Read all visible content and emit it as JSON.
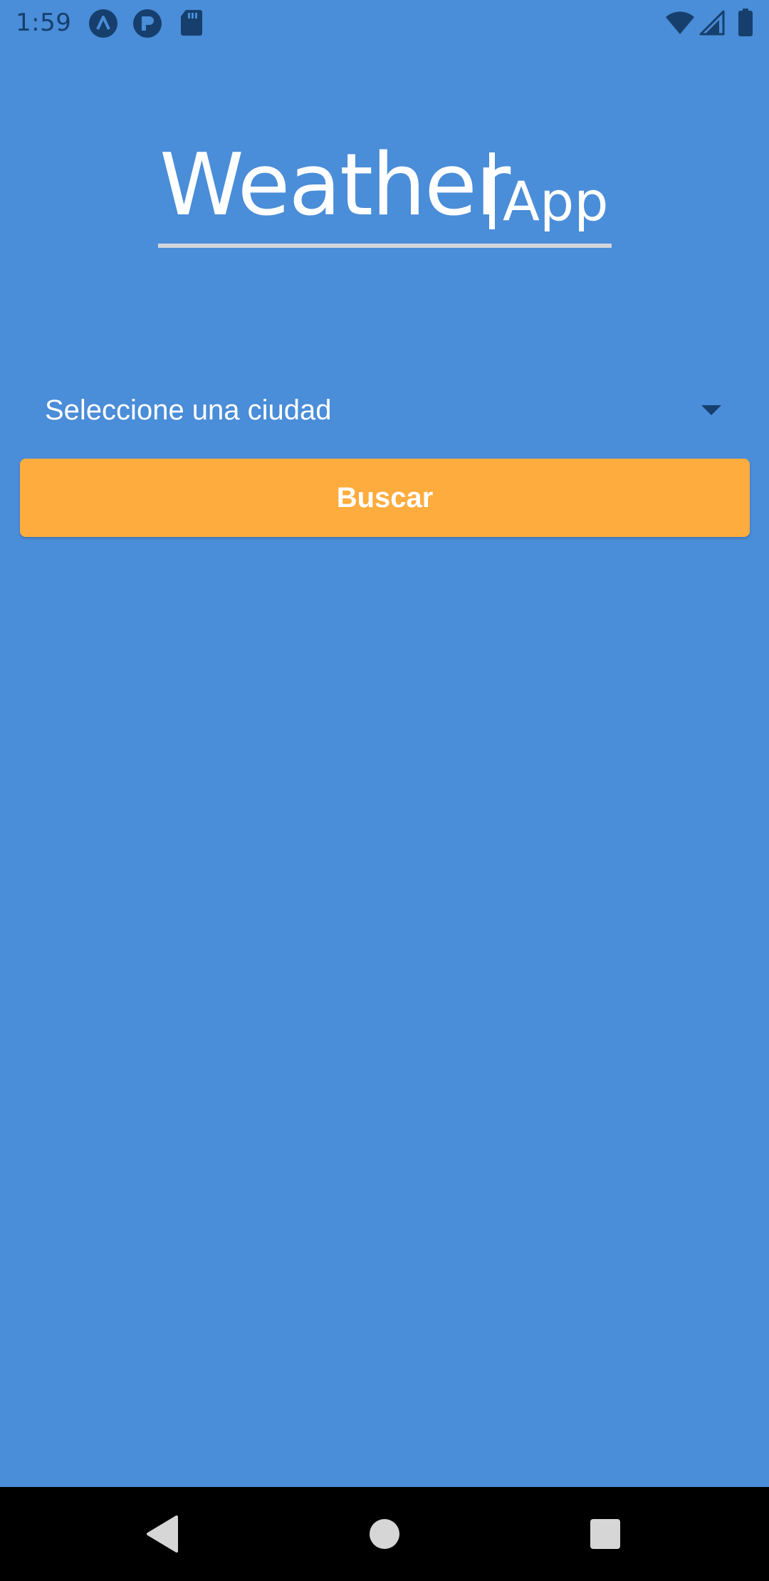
{
  "status_bar": {
    "time": "1:59",
    "icons_left": [
      "a-app-icon",
      "t-app-icon",
      "sd-card-icon"
    ],
    "icons_right": [
      "wifi-icon",
      "signal-icon",
      "battery-icon"
    ]
  },
  "app_title": {
    "main": "Weather",
    "sub": "App"
  },
  "city_select": {
    "label": "Seleccione una ciudad"
  },
  "search_button": {
    "label": "Buscar"
  },
  "nav_bar": {
    "buttons": [
      "back",
      "home",
      "recents"
    ]
  },
  "colors": {
    "background": "#4a8dd8",
    "button": "#feac3e",
    "status_icons": "#163f6d",
    "nav_bar": "#000000"
  }
}
